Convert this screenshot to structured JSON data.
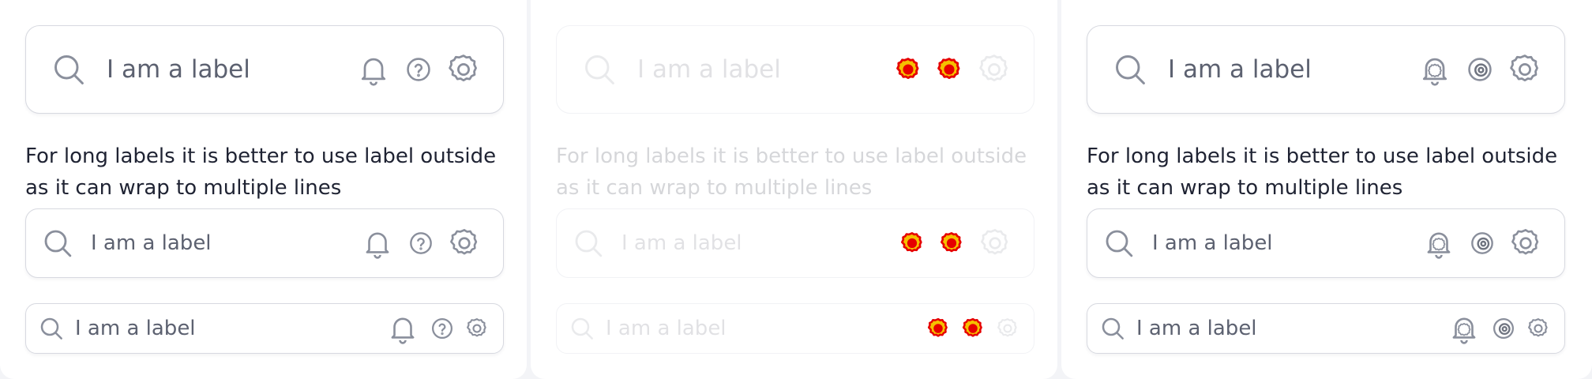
{
  "panels": [
    {
      "variant": "default",
      "large": {
        "label": "I am a label"
      },
      "helper": "For long labels it is better to use label outside as it can wrap to multiple lines",
      "medium": {
        "label": "I am a label"
      },
      "small": {
        "label": "I am a label"
      }
    },
    {
      "variant": "disabled",
      "large": {
        "label": "I am a label"
      },
      "helper": "For long labels it is better to use label outside as it can wrap to multiple lines",
      "medium": {
        "label": "I am a label"
      },
      "small": {
        "label": "I am a label"
      }
    },
    {
      "variant": "error-icons",
      "large": {
        "label": "I am a label"
      },
      "helper": "For long labels it is better to use label outside as it can wrap to multiple lines",
      "medium": {
        "label": "I am a label"
      },
      "small": {
        "label": "I am a label"
      }
    }
  ],
  "icons": [
    "search-icon",
    "bell-icon",
    "help-circle-icon",
    "gear-icon"
  ],
  "colors": {
    "text": "#1f2333",
    "label": "#5c6170",
    "border": "#d7d9e0",
    "icon": "#8a8f9c",
    "error_icon_fill": "#f5c000",
    "error_icon_stroke": "#e60000"
  }
}
